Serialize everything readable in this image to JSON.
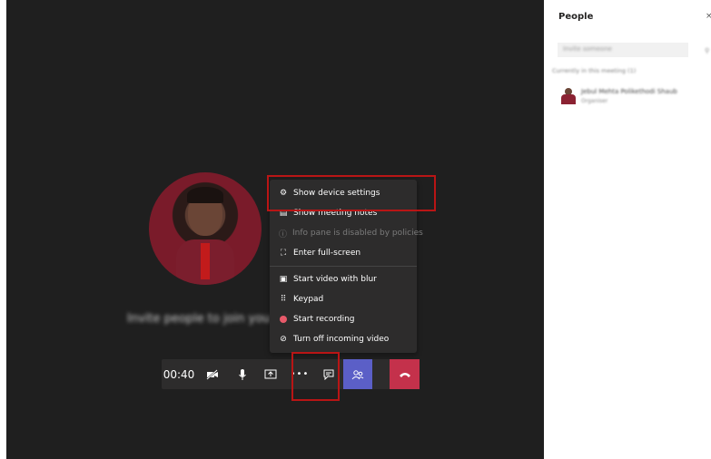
{
  "meeting": {
    "invite_text": "Invite people to join you",
    "timer": "00:40"
  },
  "more_menu": {
    "items": [
      {
        "label": "Show device settings",
        "icon": "gear-icon",
        "enabled": true
      },
      {
        "label": "Show meeting notes",
        "icon": "notes-icon",
        "enabled": true
      },
      {
        "label": "Info pane is disabled by policies",
        "icon": "info-icon",
        "enabled": false
      },
      {
        "label": "Enter full-screen",
        "icon": "fullscreen-icon",
        "enabled": true
      },
      {
        "label": "Start video with blur",
        "icon": "blur-icon",
        "enabled": true
      },
      {
        "label": "Keypad",
        "icon": "keypad-icon",
        "enabled": true
      },
      {
        "label": "Start recording",
        "icon": "record-icon",
        "enabled": true
      },
      {
        "label": "Turn off incoming video",
        "icon": "video-off-icon",
        "enabled": true
      }
    ]
  },
  "toolbar": {
    "camera_icon": "camera-off-icon",
    "mic_icon": "mic-icon",
    "share_icon": "share-screen-icon",
    "more_label": "•••",
    "chat_icon": "chat-icon",
    "people_icon": "people-icon",
    "hangup_icon": "hang-up-icon"
  },
  "people_panel": {
    "title": "People",
    "close": "×",
    "search_placeholder": "Invite someone",
    "search_more": "⚲",
    "section_header": "Currently in this meeting (1)",
    "participants": [
      {
        "name": "Jebul Mehta Polikethodi Shaub",
        "role": "Organiser"
      }
    ]
  },
  "colors": {
    "stage_bg": "#1f1f1f",
    "menu_bg": "#2d2c2c",
    "highlight": "#b91515",
    "people_active": "#5b5fc7",
    "hangup": "#c4314b",
    "record_dot": "#e85a6a"
  }
}
